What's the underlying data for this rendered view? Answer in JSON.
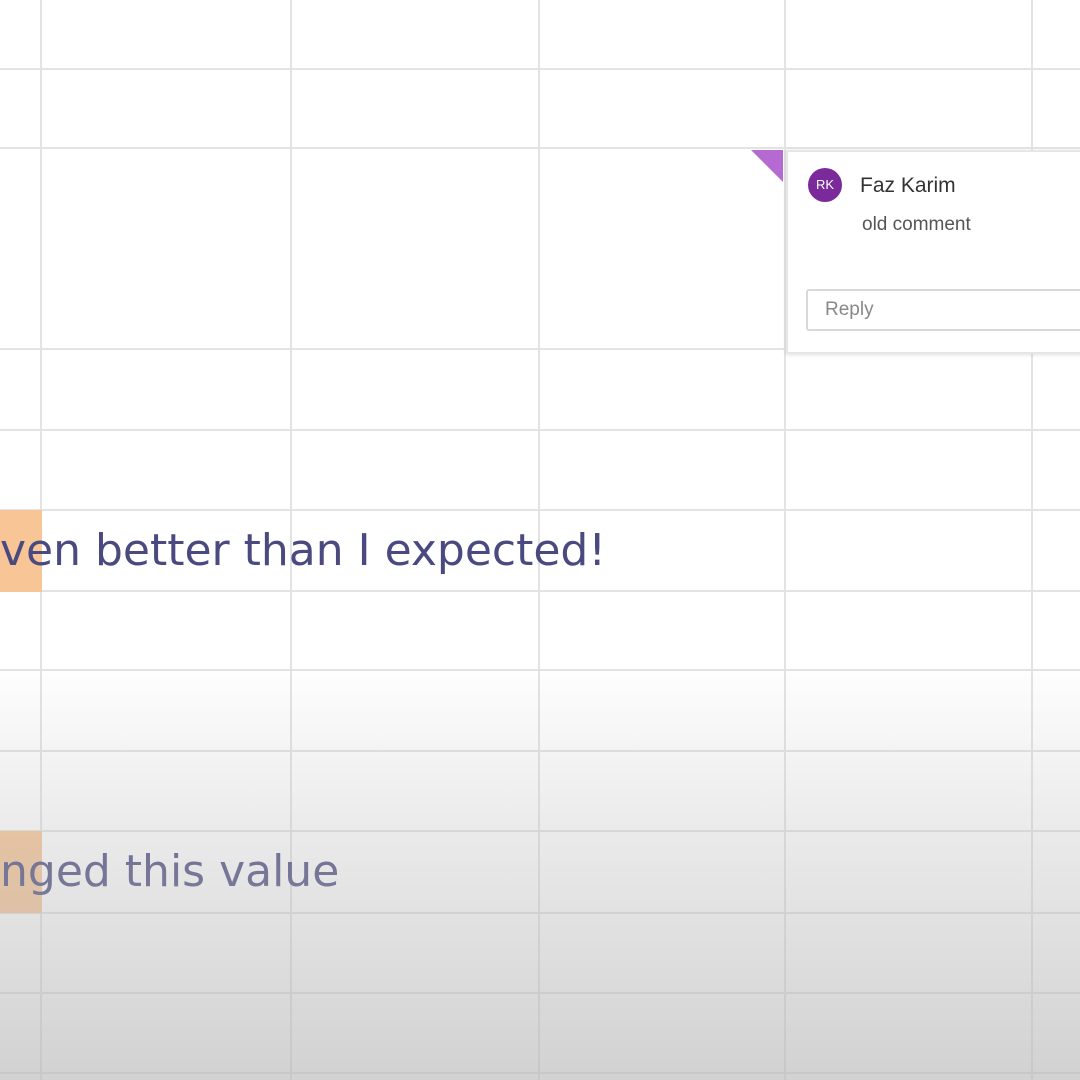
{
  "comment": {
    "avatar_initials": "RK",
    "author": "Faz Karim",
    "text": "old comment",
    "reply_placeholder": "Reply",
    "marker_color": "#b56ad1",
    "avatar_color": "#7a2a9a"
  },
  "cells": [
    {
      "text": "ven better than I expected!",
      "highlight_color": "#f7c596"
    },
    {
      "text": "nged this value",
      "highlight_color": "#f7c596"
    }
  ],
  "colors": {
    "cell_text": "#4a4a80",
    "gridline": "#e3e3e3"
  }
}
